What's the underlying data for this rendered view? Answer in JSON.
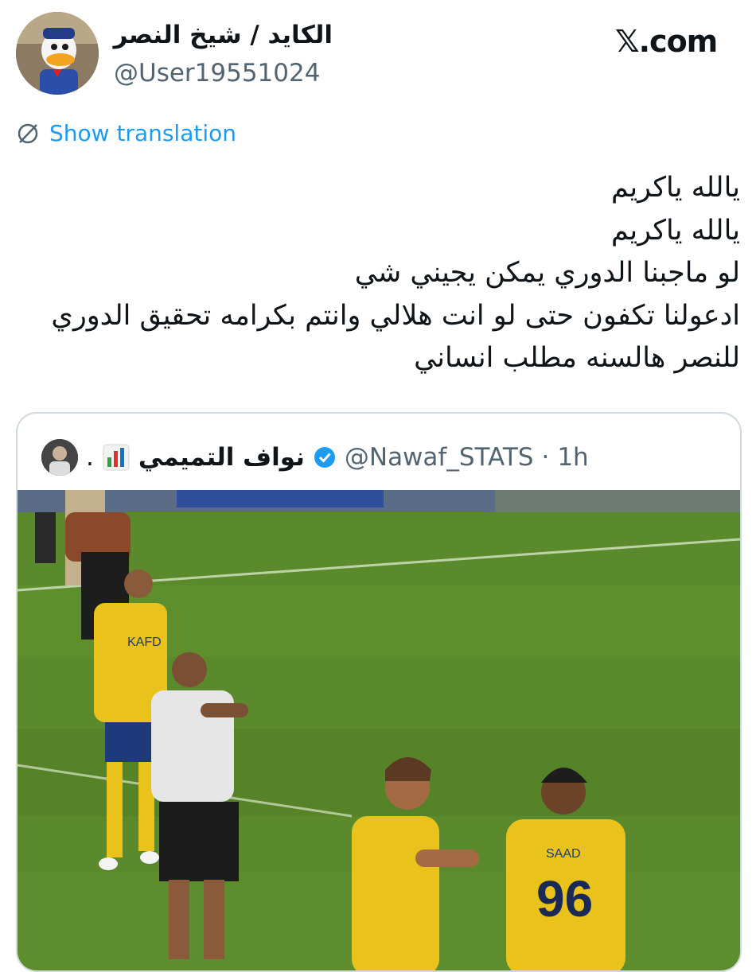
{
  "author": {
    "display_name": "الكايد / شيخ النصر",
    "handle": "@User19551024",
    "avatar_icon": "donald-duck-avatar"
  },
  "brand": {
    "label": "𝕏.com"
  },
  "translation": {
    "label": "Show translation",
    "icon": "translate-globe-icon"
  },
  "tweet": {
    "lines": [
      "يالله ياكريم",
      "يالله ياكريم",
      "لو ماجبنا الدوري يمكن يجيني شي",
      "ادعولنا تكفون حتى لو انت هلالي وانتم بكرامه تحقيق الدوري",
      "للنصر هالسنه مطلب انساني"
    ]
  },
  "quoted": {
    "name": "نواف التميمي",
    "name_suffix": ".",
    "chart_emoji_icon": "bar-chart-icon",
    "verified_icon": "verified-badge-icon",
    "handle": "@Nawaf_STATS",
    "separator": "·",
    "time": "1h",
    "accent_color": "#1d9bf0",
    "media": {
      "jersey_name": "SAAD",
      "jersey_number": "96",
      "sponsor": "KAFD"
    }
  }
}
